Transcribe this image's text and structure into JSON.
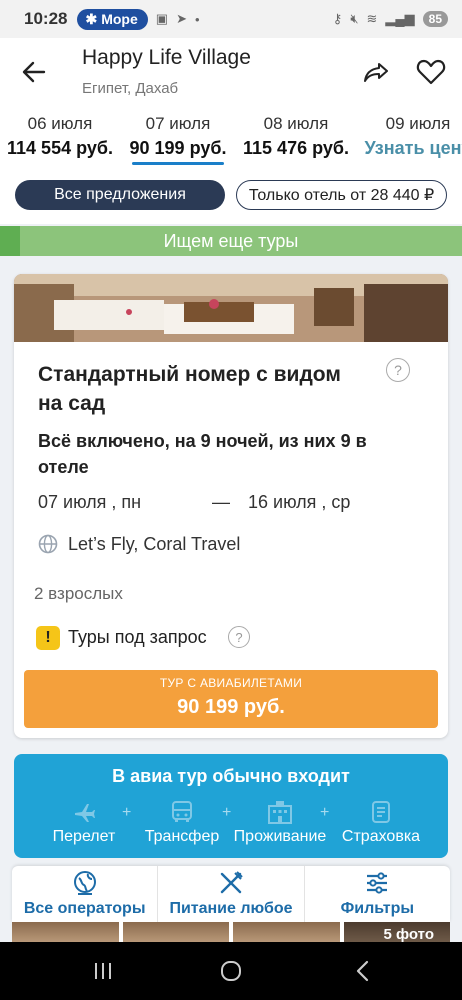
{
  "status": {
    "time": "10:28",
    "chip_label": "Море",
    "battery": "85"
  },
  "header": {
    "title": "Happy Life Village",
    "subtitle": "Египет, Дахаб"
  },
  "dates": [
    {
      "date": "06 июля",
      "price": "114 554 руб."
    },
    {
      "date": "07 июля",
      "price": "90 199 руб."
    },
    {
      "date": "08 июля",
      "price": "115 476 руб."
    },
    {
      "date": "09 июля",
      "price": "Узнать цену"
    }
  ],
  "chips": {
    "all": "Все предложения",
    "hotel_only": "Только отель от 28 440 ₽"
  },
  "banner": "Ищем еще туры",
  "card": {
    "room_title": "Стандартный номер с видом на сад",
    "help": "?",
    "meal": "Всё включено, на 9 ночей, из них 9 в отеле",
    "date_from": "07 июля , пн",
    "dash": "—",
    "date_to": "16 июля , ср",
    "operators": "Let’s Fly, Coral Travel",
    "adults": "2 взрослых",
    "warn": "!",
    "request": "Туры под запрос",
    "buy_small": "ТУР С АВИАБИЛЕТАМИ",
    "buy_price": "90 199 руб."
  },
  "avia": {
    "title": "В авиа тур обычно входит",
    "items": [
      "Перелет",
      "Трансфер",
      "Проживание",
      "Страховка"
    ]
  },
  "toolbar": {
    "operators": "Все операторы",
    "food": "Питание любое",
    "filters": "Фильтры"
  },
  "photos_count": "5 фото",
  "colors": {
    "accent_blue": "#1a7fc9",
    "orange": "#f4a03c",
    "green_banner": "#8cc47b",
    "avia_blue": "#20a3d6",
    "chip_dark": "#2b3a55"
  }
}
